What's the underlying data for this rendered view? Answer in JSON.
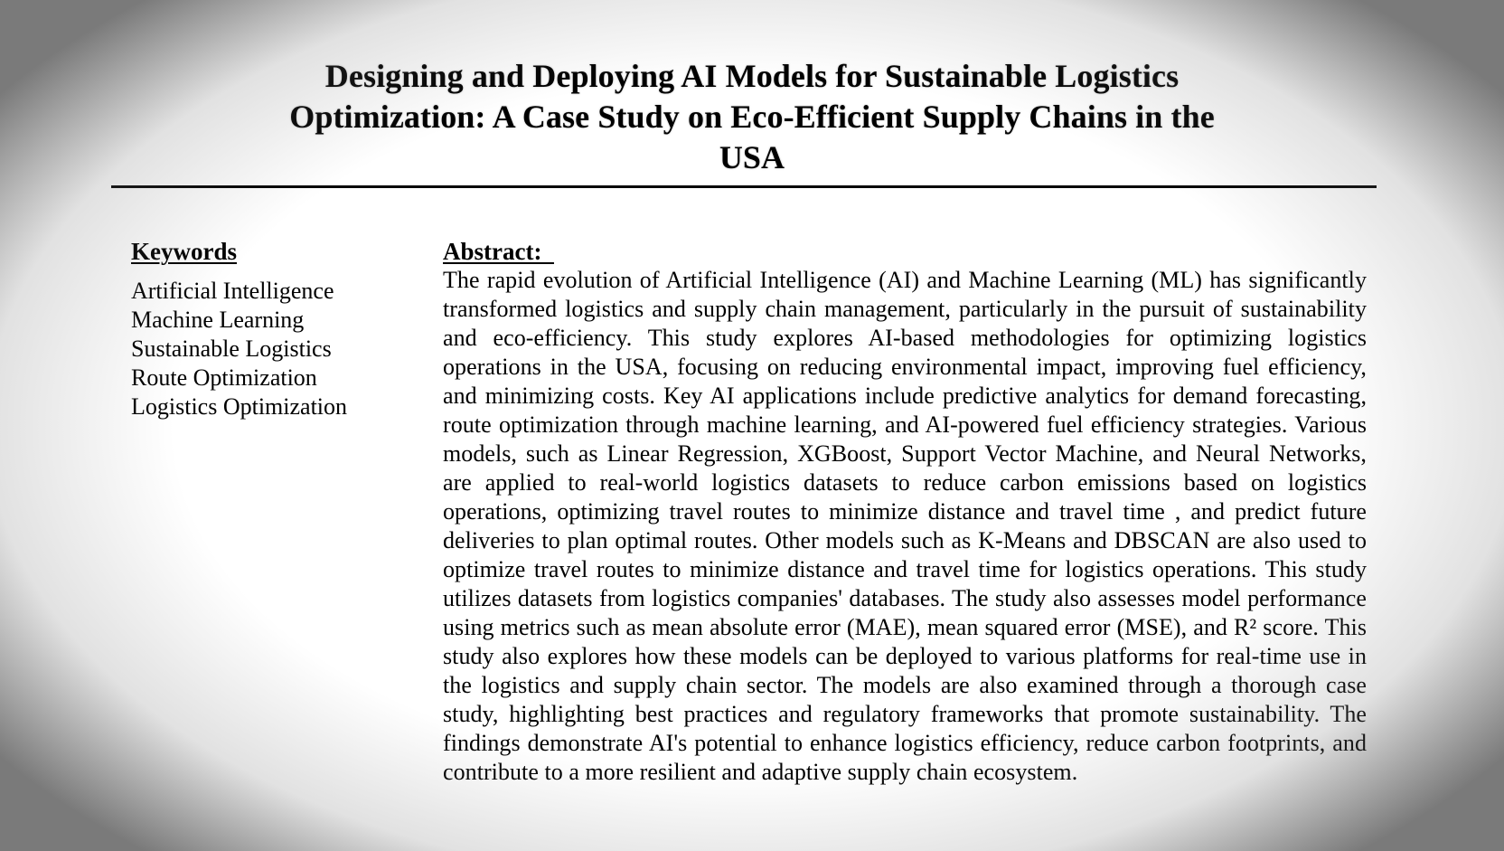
{
  "title": {
    "line1": "Designing and Deploying AI Models for Sustainable Logistics",
    "line2": "Optimization: A Case Study on Eco-Efficient Supply Chains in the",
    "line3": "USA"
  },
  "keywords": {
    "heading": "Keywords",
    "items": [
      "Artificial Intelligence",
      "Machine Learning",
      "Sustainable Logistics",
      "Route Optimization",
      "Logistics Optimization"
    ]
  },
  "abstract": {
    "heading": "Abstract:  ",
    "body": "The rapid evolution of Artificial Intelligence (AI) and Machine Learning (ML) has significantly transformed logistics and supply chain management, particularly in the pursuit of sustainability and eco-efficiency. This study explores AI-based methodologies for optimizing logistics operations in the USA, focusing on reducing environmental impact, improving fuel efficiency, and minimizing costs. Key AI applications include predictive analytics for demand forecasting, route optimization through machine learning, and AI-powered fuel efficiency strategies. Various models, such as Linear Regression, XGBoost, Support Vector Machine, and Neural Networks, are applied to real-world logistics datasets to reduce carbon emissions based on logistics operations, optimizing travel routes to minimize distance and travel time , and predict future deliveries to plan optimal routes. Other models such as K-Means and DBSCAN are also used to optimize travel routes to minimize distance and travel time for logistics operations. This study utilizes datasets from logistics companies' databases. The study also assesses model performance using metrics such as mean absolute error (MAE), mean squared error (MSE), and R² score. This study also explores how these models can be deployed to various platforms for real-time use in the logistics and supply chain sector. The models are also examined through a thorough case study, highlighting best practices and regulatory frameworks that promote sustainability. The findings demonstrate AI's potential to enhance logistics efficiency, reduce carbon footprints, and contribute to a more resilient and adaptive supply chain ecosystem."
  }
}
